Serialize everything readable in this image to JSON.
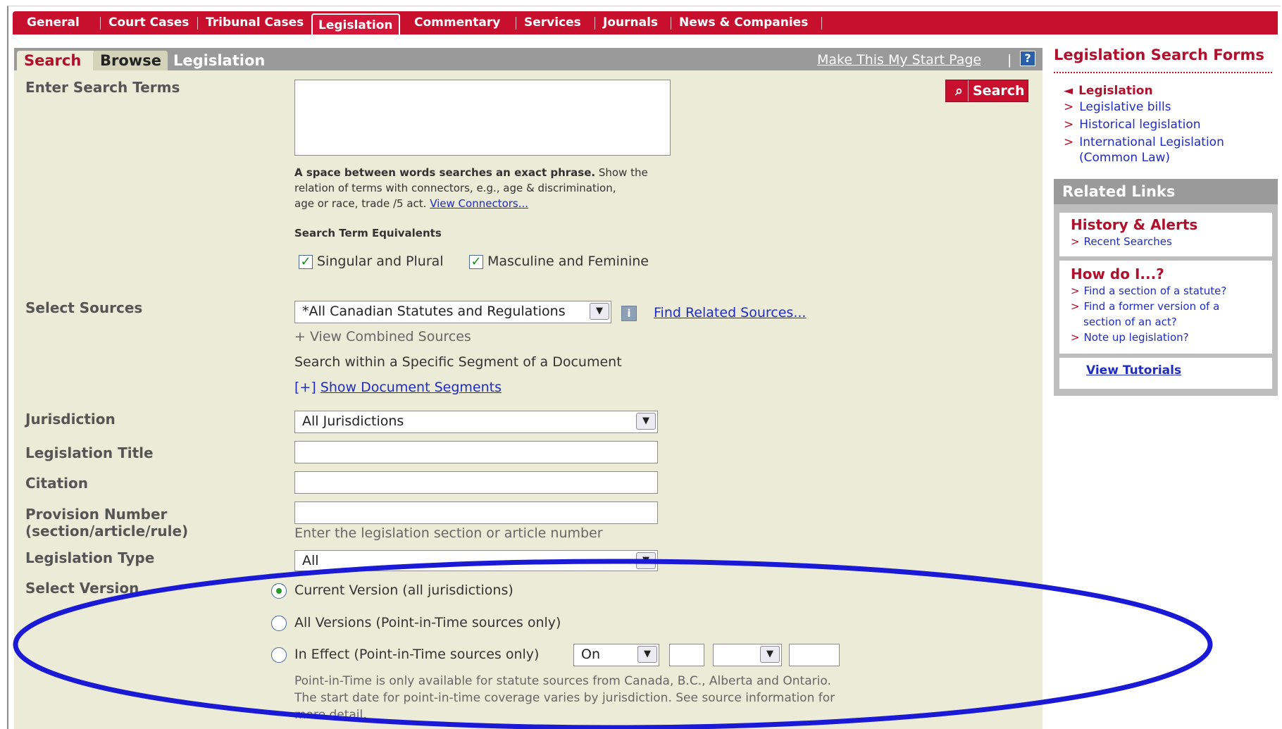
{
  "topnav": {
    "tabs": [
      "General",
      "Court Cases",
      "Tribunal Cases",
      "Legislation",
      "Commentary",
      "Services",
      "Journals",
      "News & Companies"
    ],
    "active": "Legislation"
  },
  "panel": {
    "search_tab": "Search",
    "browse_tab": "Browse",
    "title": "Legislation",
    "start_page_link": "Make This My Start Page",
    "help_icon": "?"
  },
  "search": {
    "label": "Enter Search Terms",
    "button": "Search",
    "hint_bold": "A space between words searches an exact phrase.",
    "hint_rest_1": " Show the",
    "hint_line_2": "relation of terms with connectors, e.g., age & discrimination,",
    "hint_line_3_pre": "age or race, trade /5 act.",
    "hint_link": "View Connectors...",
    "equivalents_title": "Search Term Equivalents",
    "singular_plural": "Singular and Plural",
    "masc_fem": "Masculine and Feminine"
  },
  "sources": {
    "label": "Select Sources",
    "selected": "*All Canadian Statutes and Regulations",
    "find_related": "Find Related Sources...",
    "view_combined": "+ View Combined Sources",
    "segment_text": "Search within a Specific Segment of a Document",
    "segment_prefix": "[+]",
    "segment_link": "Show Document Segments"
  },
  "fields": {
    "jurisdiction_label": "Jurisdiction",
    "jurisdiction_value": "All Jurisdictions",
    "title_label": "Legislation Title",
    "citation_label": "Citation",
    "provision_label_1": "Provision Number",
    "provision_label_2": "(section/article/rule)",
    "provision_hint": "Enter the legislation section or article number",
    "type_label": "Legislation Type",
    "type_value": "All"
  },
  "version": {
    "label": "Select Version",
    "current": "Current Version (all jurisdictions)",
    "all": "All Versions (Point-in-Time sources only)",
    "in_effect": "In Effect (Point-in-Time sources only)",
    "in_effect_select": "On",
    "note_1": "Point-in-Time is only available for statute sources from Canada, B.C., Alberta and Ontario.",
    "note_2": "The start date for point-in-time coverage varies by jurisdiction. See source information for",
    "note_3": "more detail."
  },
  "sidebar": {
    "title": "Legislation Search Forms",
    "items": [
      "Legislation",
      "Legislative bills",
      "Historical legislation",
      "International Legislation",
      "(Common Law)"
    ],
    "related_title": "Related Links",
    "history_title": "History & Alerts",
    "history_link": "Recent Searches",
    "howdo_title": "How do I...?",
    "howdo_links": [
      "Find a section of a statute?",
      "Find a former version of a",
      "section of an act?",
      "Note up legislation?"
    ],
    "tutorials": "View Tutorials"
  },
  "colors": {
    "brand_red": "#c8102e",
    "panel_bg": "#ecebd8",
    "link_blue": "#1f2cc2",
    "highlight_ellipse": "#1a1ad6"
  }
}
